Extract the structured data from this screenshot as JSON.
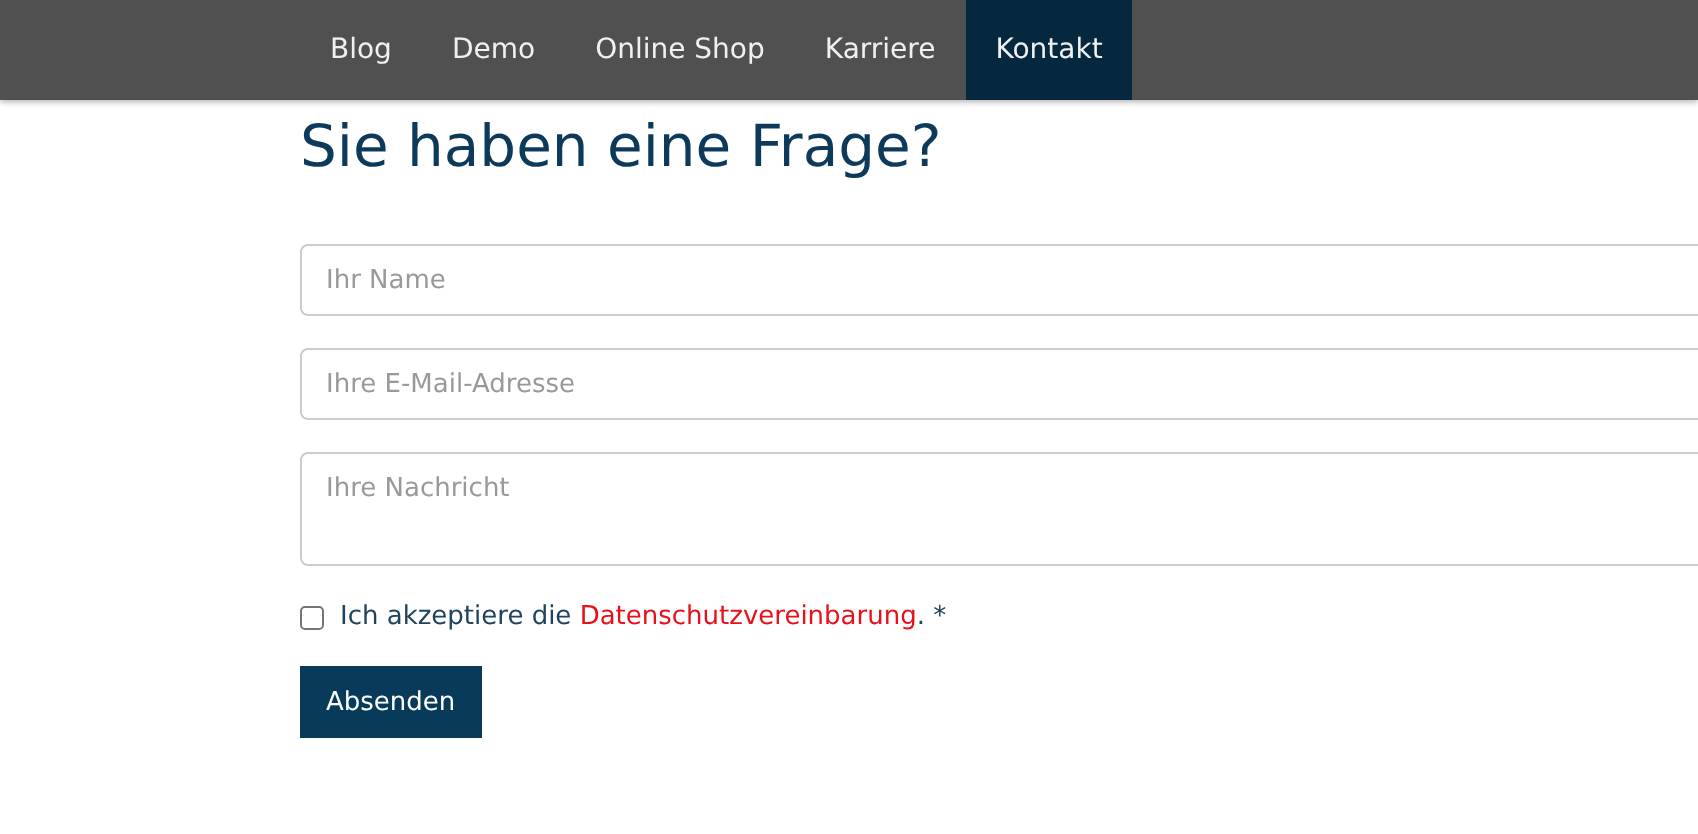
{
  "nav": [
    {
      "label": "Blog",
      "selected": false
    },
    {
      "label": "Demo",
      "selected": false
    },
    {
      "label": "Online Shop",
      "selected": false
    },
    {
      "label": "Karriere",
      "selected": false
    },
    {
      "label": "Kontakt",
      "selected": true
    }
  ],
  "title": "Sie haben eine Frage?",
  "fields": [
    {
      "kind": "input",
      "placeholder": "Ihr Name"
    },
    {
      "kind": "input",
      "placeholder": "Ihre E-Mail-Adresse"
    },
    {
      "kind": "textarea",
      "placeholder": "Ihre Nachricht"
    }
  ],
  "consent": {
    "checked": false,
    "before": "Ich akzeptiere die ",
    "link": "Datenschutzvereinbarung",
    "after": ". *"
  },
  "submit": "Absenden"
}
